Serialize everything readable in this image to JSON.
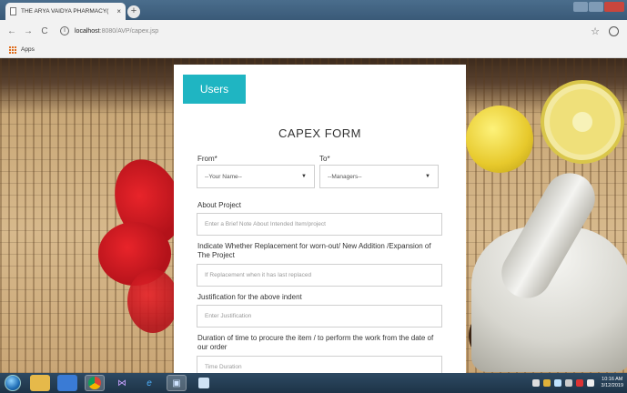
{
  "browser": {
    "tab_title": "THE ARYA VAIDYA PHARMACY(",
    "tab_close": "×",
    "new_tab": "+",
    "url_host": "localhost",
    "url_path": ":8080/AVP/capex.jsp",
    "bookmarks_apps": "Apps",
    "back": "←",
    "forward": "→",
    "reload": "C",
    "info": "i",
    "star": "☆"
  },
  "page": {
    "users_button": "Users",
    "form_title": "CAPEX  FORM",
    "from_label": "From*",
    "from_select_value": "--Your Name--",
    "to_label": "To*",
    "to_select_value": "--Managers--",
    "about_label": "About Project",
    "about_placeholder": "Enter a Brief Note About Intended Item/project",
    "replacement_label": "Indicate Whether Replacement for worn-out/ New Addition /Expansion of The Project",
    "replacement_placeholder": "If Replacement when it has last replaced",
    "justification_label": "Justification for the above indent",
    "justification_placeholder": "Enter Justification",
    "duration_label": "Duration of time to procure the item / to perform the work from the date of our order",
    "duration_placeholder": "Time Duration"
  },
  "taskbar": {
    "time": "10:16 AM",
    "date": "3/12/2019"
  },
  "colors": {
    "accent": "#1fb5c2"
  }
}
